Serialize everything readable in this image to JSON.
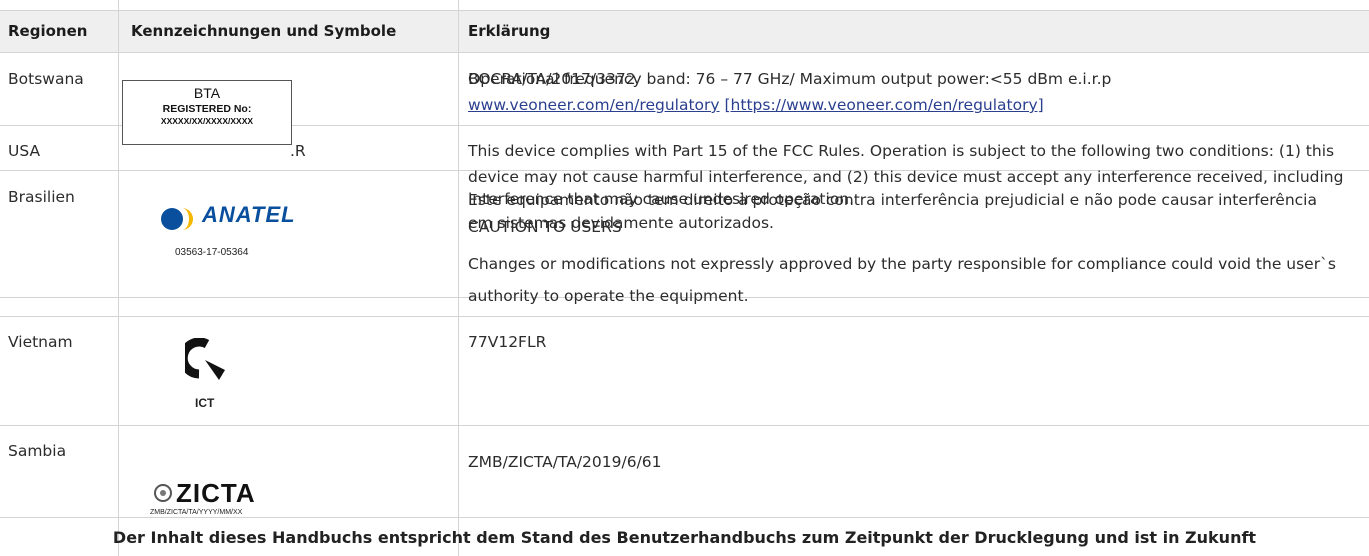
{
  "table": {
    "headers": {
      "region": "Regionen",
      "symbols": "Kennzeichnungen und Symbole",
      "explanation": "Erklärung"
    },
    "rows": {
      "botswana": {
        "region": "Botswana",
        "bta": {
          "name": "BTA",
          "registered": "REGISTERED No:",
          "number": "XXXXX/XX/XXXX/XXXX"
        },
        "text_a": "BOCRA/TA/2017/3372",
        "text_b": "Operational frequency band: 76 – 77 GHz/ Maximum output power:<55 dBm e.i.r.p",
        "link_text": "www.veoneer.com/en/regulatory",
        "link_bracket": "[https://www.veoneer.com/en/regulatory]"
      },
      "usa": {
        "region": "USA",
        "symbol_fragment": ".R",
        "line1": "This device complies with Part 15 of the FCC Rules. Operation is subject to the following two conditions: (1) this",
        "line2": "device may not cause harmful interference, and (2) this device must accept any interference received, including",
        "line3": "interference that may cause undesired operation."
      },
      "brasilien": {
        "region": "Brasilien",
        "logo_text": "ANATEL",
        "logo_number": "03563-17-05364",
        "line1": "Este equipamento não tem direito à proteção contra interferência prejudicial e não pode causar interferência",
        "line2": "em sistemas devidamente autorizados.",
        "caution": "CAUTION TO USERS",
        "changes1": "Changes or modifications not expressly approved by the party responsible for compliance could void the user`s",
        "changes2": "authority to operate the equipment."
      },
      "vietnam": {
        "region": "Vietnam",
        "logo_label": "ICT",
        "text": "77V12FLR"
      },
      "sambia": {
        "region": "Sambia",
        "logo_text": "ZICTA",
        "logo_code": "ZMB/ZICTA/TA/YYYY/MM/XX",
        "text": "ZMB/ZICTA/TA/2019/6/61"
      }
    }
  },
  "footer": "Der Inhalt dieses Handbuchs entspricht dem Stand des Benutzerhandbuchs zum Zeitpunkt der Drucklegung und ist in Zukunft",
  "colors": {
    "link": "#2b3f8f",
    "anatel_blue": "#0a4f9e",
    "anatel_yellow": "#f5b800",
    "grid": "#d4d4d4",
    "header_bg": "#efefef"
  }
}
